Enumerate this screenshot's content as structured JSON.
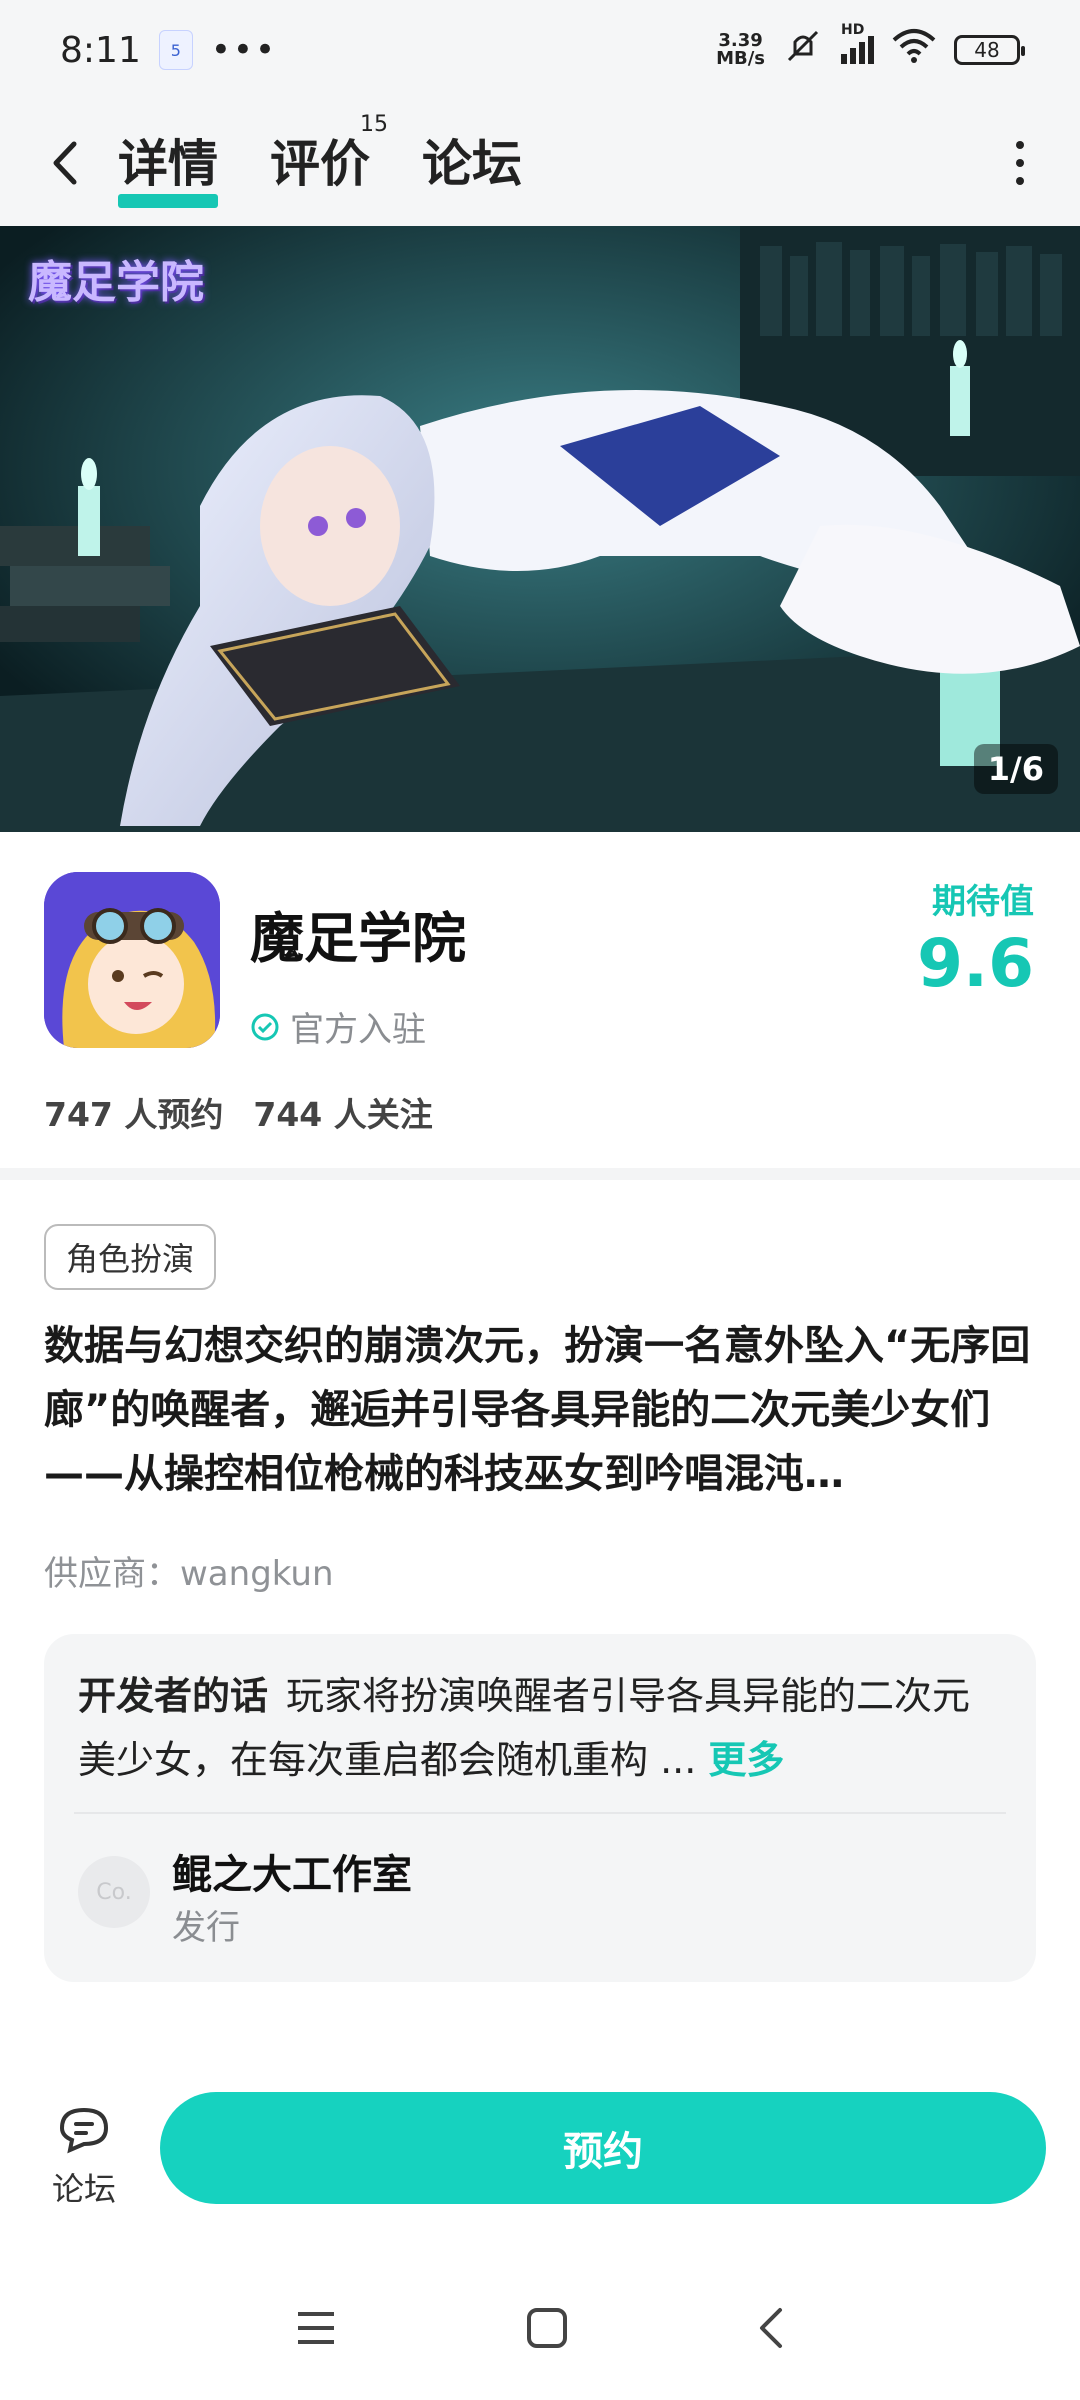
{
  "status_bar": {
    "time": "8:11",
    "app_badge": "5",
    "dots": "•••",
    "net_speed_value": "3.39",
    "net_speed_unit": "MB/s",
    "hd": "HD",
    "battery": "48"
  },
  "nav": {
    "tabs": [
      {
        "label": "详情"
      },
      {
        "label": "评价",
        "badge": "15"
      },
      {
        "label": "论坛"
      }
    ]
  },
  "banner": {
    "logo_text": "魔足学院",
    "counter": "1/6"
  },
  "game": {
    "name": "魔足学院",
    "official_label": "官方入驻",
    "expect_label": "期待值",
    "expect_value": "9.6",
    "reservations": "747 人预约",
    "followers": "744 人关注"
  },
  "details": {
    "tag": "角色扮演",
    "description": "数据与幻想交织的崩溃次元，扮演一名意外坠入“无序回廊”的唤醒者，邂逅并引导各具异能的二次元美少女们——从操控相位枪械的科技巫女到吟唱混沌…",
    "supplier": "供应商：wangkun"
  },
  "developer": {
    "label": "开发者的话",
    "text": "玩家将扮演唤醒者引导各具异能的二次元美少女，在每次重启都会随机重构 ...",
    "more": "更多",
    "avatar_text": "Co.",
    "publisher_name": "鲲之大工作室",
    "publisher_role": "发行"
  },
  "bottom": {
    "forum_label": "论坛",
    "reserve_label": "预约"
  },
  "colors": {
    "accent": "#16c7b4",
    "button": "#16d2bf"
  }
}
